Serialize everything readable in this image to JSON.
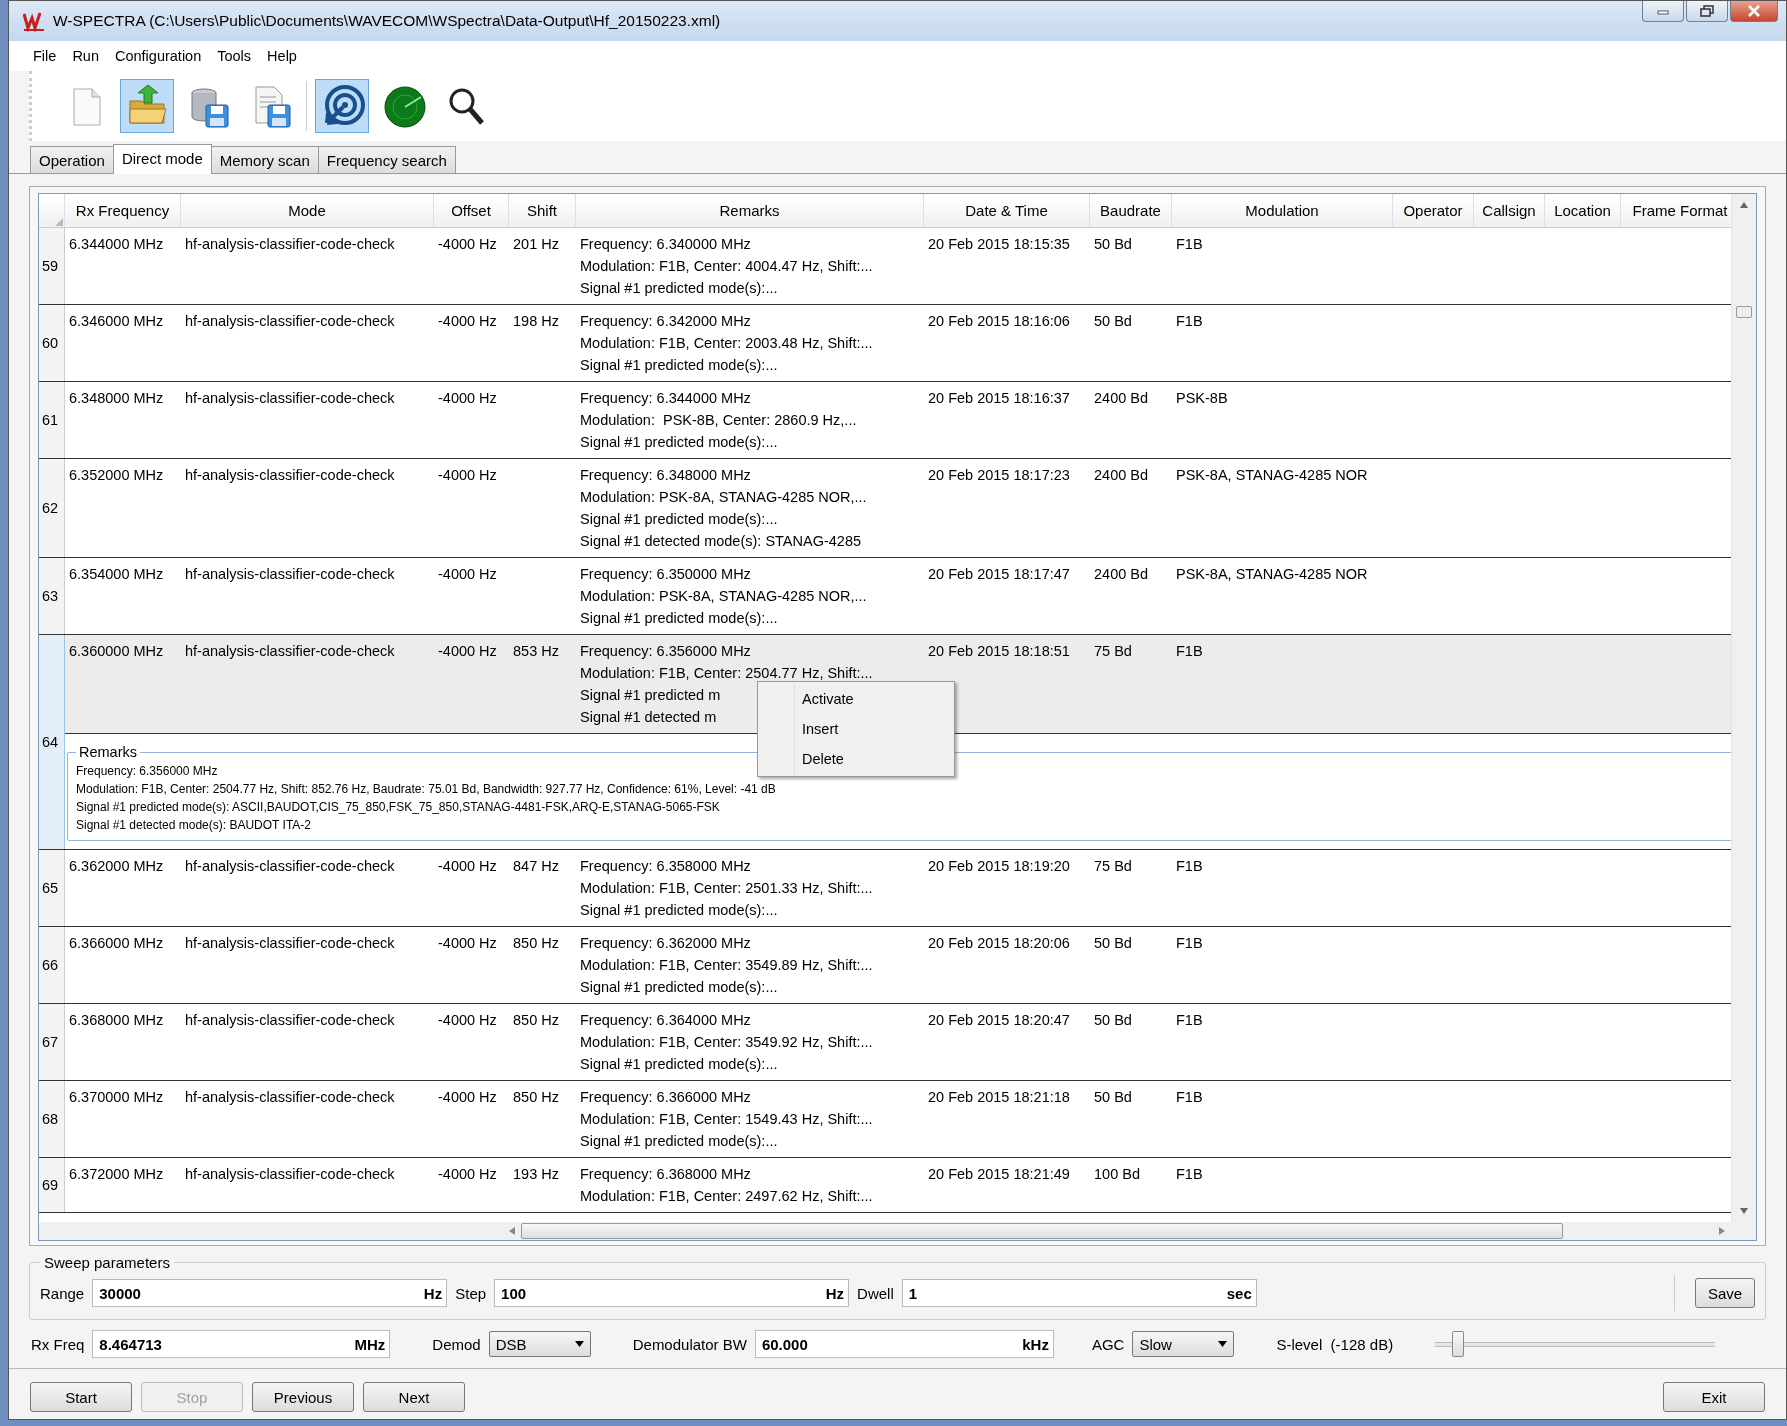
{
  "window": {
    "title": "W-SPECTRA (C:\\Users\\Public\\Documents\\WAVECOM\\WSpectra\\Data-Output\\Hf_20150223.xml)"
  },
  "menu": [
    "File",
    "Run",
    "Configuration",
    "Tools",
    "Help"
  ],
  "toolbar": [
    {
      "kind": "new",
      "pressed": false
    },
    {
      "kind": "open",
      "pressed": true
    },
    {
      "kind": "save-db",
      "pressed": false
    },
    {
      "kind": "save-doc",
      "pressed": false
    },
    {
      "kind": "separator"
    },
    {
      "kind": "target",
      "pressed": true
    },
    {
      "kind": "radar",
      "pressed": false
    },
    {
      "kind": "search",
      "pressed": false
    }
  ],
  "tabs": [
    {
      "label": "Operation",
      "selected": false
    },
    {
      "label": "Direct mode",
      "selected": true
    },
    {
      "label": "Memory scan",
      "selected": false
    },
    {
      "label": "Frequency search",
      "selected": false
    }
  ],
  "table": {
    "columns": [
      "Rx Frequency",
      "Mode",
      "Offset",
      "Shift",
      "Remarks",
      "Date & Time",
      "Baudrate",
      "Modulation",
      "Operator",
      "Callsign",
      "Location",
      "Frame Format"
    ],
    "rows": [
      {
        "number": "59",
        "selected": false,
        "rx_frequency": "6.344000 MHz",
        "mode": "hf-analysis-classifier-code-check",
        "offset": "-4000 Hz",
        "shift": "201 Hz",
        "remarks": [
          "Frequency: 6.340000 MHz",
          "Modulation: F1B, Center: 4004.47 Hz, Shift:...",
          "Signal #1 predicted mode(s):..."
        ],
        "date_time": "20 Feb 2015 18:15:35",
        "baudrate": "50 Bd",
        "modulation": "F1B"
      },
      {
        "number": "60",
        "selected": false,
        "rx_frequency": "6.346000 MHz",
        "mode": "hf-analysis-classifier-code-check",
        "offset": "-4000 Hz",
        "shift": "198 Hz",
        "remarks": [
          "Frequency: 6.342000 MHz",
          "Modulation: F1B, Center: 2003.48 Hz, Shift:...",
          "Signal #1 predicted mode(s):..."
        ],
        "date_time": "20 Feb 2015 18:16:06",
        "baudrate": "50 Bd",
        "modulation": "F1B"
      },
      {
        "number": "61",
        "selected": false,
        "rx_frequency": "6.348000 MHz",
        "mode": "hf-analysis-classifier-code-check",
        "offset": "-4000 Hz",
        "remarks": [
          "Frequency: 6.344000 MHz",
          "Modulation:  PSK-8B, Center: 2860.9 Hz,...",
          "Signal #1 predicted mode(s):..."
        ],
        "date_time": "20 Feb 2015 18:16:37",
        "baudrate": "2400 Bd",
        "modulation": " PSK-8B"
      },
      {
        "number": "62",
        "selected": false,
        "rx_frequency": "6.352000 MHz",
        "mode": "hf-analysis-classifier-code-check",
        "offset": "-4000 Hz",
        "remarks": [
          "Frequency: 6.348000 MHz",
          "Modulation: PSK-8A, STANAG-4285 NOR,...",
          "Signal #1 predicted mode(s):...",
          "Signal #1 detected mode(s): STANAG-4285"
        ],
        "date_time": "20 Feb 2015 18:17:23",
        "baudrate": "2400 Bd",
        "modulation": "PSK-8A, STANAG-4285 NOR"
      },
      {
        "number": "63",
        "selected": false,
        "rx_frequency": "6.354000 MHz",
        "mode": "hf-analysis-classifier-code-check",
        "offset": "-4000 Hz",
        "remarks": [
          "Frequency: 6.350000 MHz",
          "Modulation: PSK-8A, STANAG-4285 NOR,...",
          "Signal #1 predicted mode(s):..."
        ],
        "date_time": "20 Feb 2015 18:17:47",
        "baudrate": "2400 Bd",
        "modulation": "PSK-8A, STANAG-4285 NOR"
      },
      {
        "number": "64",
        "selected": true,
        "rx_frequency": "6.360000 MHz",
        "mode": "hf-analysis-classifier-code-check",
        "offset": "-4000 Hz",
        "shift": "853 Hz",
        "remarks": [
          "Frequency: 6.356000 MHz",
          "Modulation: F1B, Center: 2504.77 Hz, Shift:...",
          "Signal #1 predicted m",
          "Signal #1 detected m"
        ],
        "date_time": "20 Feb 2015 18:18:51",
        "baudrate": "75 Bd",
        "modulation": "F1B",
        "details": {
          "title": "Remarks",
          "lines": [
            "Frequency: 6.356000 MHz",
            "Modulation: F1B, Center: 2504.77 Hz, Shift: 852.76 Hz, Baudrate: 75.01 Bd, Bandwidth: 927.77 Hz, Confidence: 61%, Level: -41 dB",
            "Signal #1 predicted mode(s): ASCII,BAUDOT,CIS_75_850,FSK_75_850,STANAG-4481-FSK,ARQ-E,STANAG-5065-FSK",
            "Signal #1 detected mode(s): BAUDOT ITA-2"
          ]
        }
      },
      {
        "number": "65",
        "selected": false,
        "rx_frequency": "6.362000 MHz",
        "mode": "hf-analysis-classifier-code-check",
        "offset": "-4000 Hz",
        "shift": "847 Hz",
        "remarks": [
          "Frequency: 6.358000 MHz",
          "Modulation: F1B, Center: 2501.33 Hz, Shift:...",
          "Signal #1 predicted mode(s):..."
        ],
        "date_time": "20 Feb 2015 18:19:20",
        "baudrate": "75 Bd",
        "modulation": "F1B"
      },
      {
        "number": "66",
        "selected": false,
        "rx_frequency": "6.366000 MHz",
        "mode": "hf-analysis-classifier-code-check",
        "offset": "-4000 Hz",
        "shift": "850 Hz",
        "remarks": [
          "Frequency: 6.362000 MHz",
          "Modulation: F1B, Center: 3549.89 Hz, Shift:...",
          "Signal #1 predicted mode(s):..."
        ],
        "date_time": "20 Feb 2015 18:20:06",
        "baudrate": "50 Bd",
        "modulation": "F1B"
      },
      {
        "number": "67",
        "selected": false,
        "rx_frequency": "6.368000 MHz",
        "mode": "hf-analysis-classifier-code-check",
        "offset": "-4000 Hz",
        "shift": "850 Hz",
        "remarks": [
          "Frequency: 6.364000 MHz",
          "Modulation: F1B, Center: 3549.92 Hz, Shift:...",
          "Signal #1 predicted mode(s):..."
        ],
        "date_time": "20 Feb 2015 18:20:47",
        "baudrate": "50 Bd",
        "modulation": "F1B"
      },
      {
        "number": "68",
        "selected": false,
        "rx_frequency": "6.370000 MHz",
        "mode": "hf-analysis-classifier-code-check",
        "offset": "-4000 Hz",
        "shift": "850 Hz",
        "remarks": [
          "Frequency: 6.366000 MHz",
          "Modulation: F1B, Center: 1549.43 Hz, Shift:...",
          "Signal #1 predicted mode(s):..."
        ],
        "date_time": "20 Feb 2015 18:21:18",
        "baudrate": "50 Bd",
        "modulation": "F1B"
      },
      {
        "number": "69",
        "selected": false,
        "rx_frequency": "6.372000 MHz",
        "mode": "hf-analysis-classifier-code-check",
        "offset": "-4000 Hz",
        "shift": "193 Hz",
        "remarks": [
          "Frequency: 6.368000 MHz",
          "Modulation: F1B, Center: 2497.62 Hz, Shift:..."
        ],
        "date_time": "20 Feb 2015 18:21:49",
        "baudrate": "100 Bd",
        "modulation": "F1B"
      }
    ]
  },
  "context_menu": [
    "Activate",
    "Insert",
    "Delete"
  ],
  "sweep_parameters": {
    "title": "Sweep parameters",
    "fields": [
      {
        "label": "Range",
        "value": "30000",
        "unit": "Hz"
      },
      {
        "label": "Step",
        "value": "100",
        "unit": "Hz"
      },
      {
        "label": "Dwell",
        "value": "1",
        "unit": "sec"
      }
    ],
    "button": "Save"
  },
  "receiver": {
    "rx_freq": {
      "label": "Rx Freq",
      "value": "8.464713",
      "unit": "MHz"
    },
    "demod": {
      "label": "Demod",
      "value": "DSB"
    },
    "demod_bw": {
      "label": "Demodulator BW",
      "value": "60.000",
      "unit": "kHz"
    },
    "agc": {
      "label": "AGC",
      "value": "Slow"
    },
    "s_level": {
      "label": "S-level  (-128 dB)",
      "level": 0.08
    }
  },
  "buttons": [
    {
      "label": "Start",
      "disabled": false
    },
    {
      "label": "Stop",
      "disabled": true
    },
    {
      "label": "Previous",
      "disabled": false
    },
    {
      "label": "Next",
      "disabled": false
    },
    {
      "label": "Exit",
      "disabled": false
    }
  ]
}
